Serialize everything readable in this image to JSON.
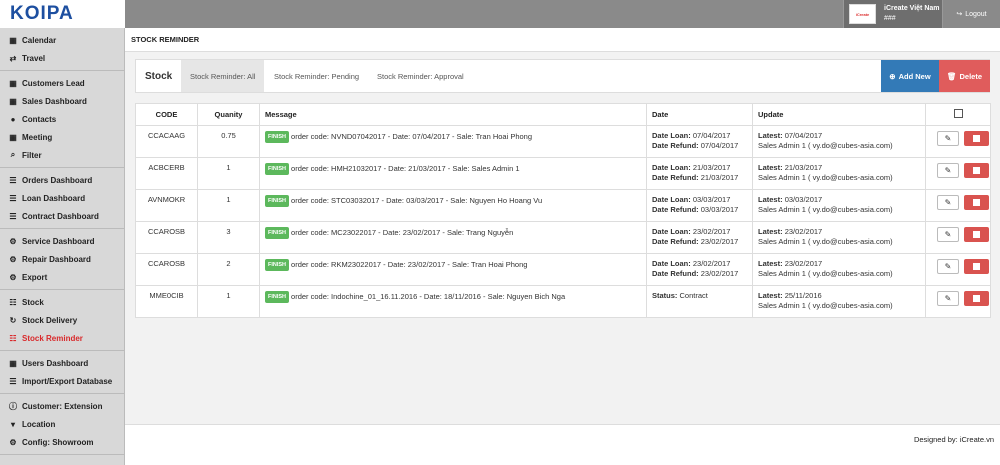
{
  "brand": {
    "logo_text": "KOIPA"
  },
  "user": {
    "avatar_text": "iCreate",
    "name": "iCreate Việt Nam",
    "role": "###"
  },
  "header_actions": {
    "logout_label": "Logout"
  },
  "sidebar": {
    "groups": [
      [
        {
          "label": "Calendar",
          "icon": "calendar-icon"
        },
        {
          "label": "Travel",
          "icon": "exchange-icon"
        }
      ],
      [
        {
          "label": "Customers Lead",
          "icon": "th-icon"
        },
        {
          "label": "Sales Dashboard",
          "icon": "th-icon"
        },
        {
          "label": "Contacts",
          "icon": "user-icon"
        },
        {
          "label": "Meeting",
          "icon": "calendar-icon"
        },
        {
          "label": "Filter",
          "icon": "search-icon"
        }
      ],
      [
        {
          "label": "Orders Dashboard",
          "icon": "list-icon"
        },
        {
          "label": "Loan Dashboard",
          "icon": "list-icon"
        },
        {
          "label": "Contract Dashboard",
          "icon": "list-icon"
        }
      ],
      [
        {
          "label": "Service Dashboard",
          "icon": "gears-icon"
        },
        {
          "label": "Repair Dashboard",
          "icon": "gears-icon"
        },
        {
          "label": "Export",
          "icon": "gears-icon"
        }
      ],
      [
        {
          "label": "Stock",
          "icon": "database-icon"
        },
        {
          "label": "Stock Delivery",
          "icon": "refresh-icon"
        },
        {
          "label": "Stock Reminder",
          "icon": "database-icon",
          "active": true
        }
      ],
      [
        {
          "label": "Users Dashboard",
          "icon": "th-icon"
        },
        {
          "label": "Import/Export Database",
          "icon": "list-icon"
        }
      ],
      [
        {
          "label": "Customer: Extension",
          "icon": "info-icon"
        },
        {
          "label": "Location",
          "icon": "map-marker-icon"
        },
        {
          "label": "Config: Showroom",
          "icon": "gear-icon"
        }
      ]
    ]
  },
  "page": {
    "title": "STOCK REMINDER"
  },
  "panel": {
    "title": "Stock",
    "tabs": [
      "Stock Reminder: All",
      "Stock Reminder: Pending",
      "Stock Reminder: Approval"
    ],
    "add_label": "Add New",
    "delete_label": "Delete"
  },
  "table": {
    "headers": [
      "CODE",
      "Quanity",
      "Message",
      "Date",
      "Update"
    ],
    "badge": "FINISH",
    "rows": [
      {
        "code": "CCACAAG",
        "qty": "0.75",
        "message": "order code: NVND07042017 - Date: 07/04/2017 - Sale: Tran Hoai Phong",
        "date1_label": "Date Loan:",
        "date1": "07/04/2017",
        "date2_label": "Date Refund:",
        "date2": "07/04/2017",
        "latest_label": "Latest:",
        "latest": "07/04/2017",
        "by": "Sales Admin 1 ( vy.do@cubes-asia.com)"
      },
      {
        "code": "ACBCERB",
        "qty": "1",
        "message": "order code: HMH21032017 - Date: 21/03/2017 - Sale: Sales Admin 1",
        "date1_label": "Date Loan:",
        "date1": "21/03/2017",
        "date2_label": "Date Refund:",
        "date2": "21/03/2017",
        "latest_label": "Latest:",
        "latest": "21/03/2017",
        "by": "Sales Admin 1 ( vy.do@cubes-asia.com)"
      },
      {
        "code": "AVNMOKR",
        "qty": "1",
        "message": "order code: STC03032017 - Date: 03/03/2017 - Sale: Nguyen Ho Hoang Vu",
        "date1_label": "Date Loan:",
        "date1": "03/03/2017",
        "date2_label": "Date Refund:",
        "date2": "03/03/2017",
        "latest_label": "Latest:",
        "latest": "03/03/2017",
        "by": "Sales Admin 1 ( vy.do@cubes-asia.com)"
      },
      {
        "code": "CCAROSB",
        "qty": "3",
        "message": "order code: MC23022017 - Date: 23/02/2017 - Sale: Trang Nguyễn",
        "date1_label": "Date Loan:",
        "date1": "23/02/2017",
        "date2_label": "Date Refund:",
        "date2": "23/02/2017",
        "latest_label": "Latest:",
        "latest": "23/02/2017",
        "by": "Sales Admin 1 ( vy.do@cubes-asia.com)"
      },
      {
        "code": "CCAROSB",
        "qty": "2",
        "message": "order code: RKM23022017 - Date: 23/02/2017 - Sale: Tran Hoai Phong",
        "date1_label": "Date Loan:",
        "date1": "23/02/2017",
        "date2_label": "Date Refund:",
        "date2": "23/02/2017",
        "latest_label": "Latest:",
        "latest": "23/02/2017",
        "by": "Sales Admin 1 ( vy.do@cubes-asia.com)"
      },
      {
        "code": "MME0CIB",
        "qty": "1",
        "message": "order code: Indochine_01_16.11.2016 - Date: 18/11/2016 - Sale: Nguyen Bich Nga",
        "date1_label": "Status:",
        "date1": "Contract",
        "date2_label": "",
        "date2": "",
        "latest_label": "Latest:",
        "latest": "25/11/2016",
        "by": "Sales Admin 1 ( vy.do@cubes-asia.com)"
      }
    ]
  },
  "footer": {
    "text": "Designed by: iCreate.vn"
  },
  "colors": {
    "primary": "#337ab7",
    "danger": "#d9534f",
    "success": "#5cb85c",
    "active_nav": "#d9292b"
  }
}
